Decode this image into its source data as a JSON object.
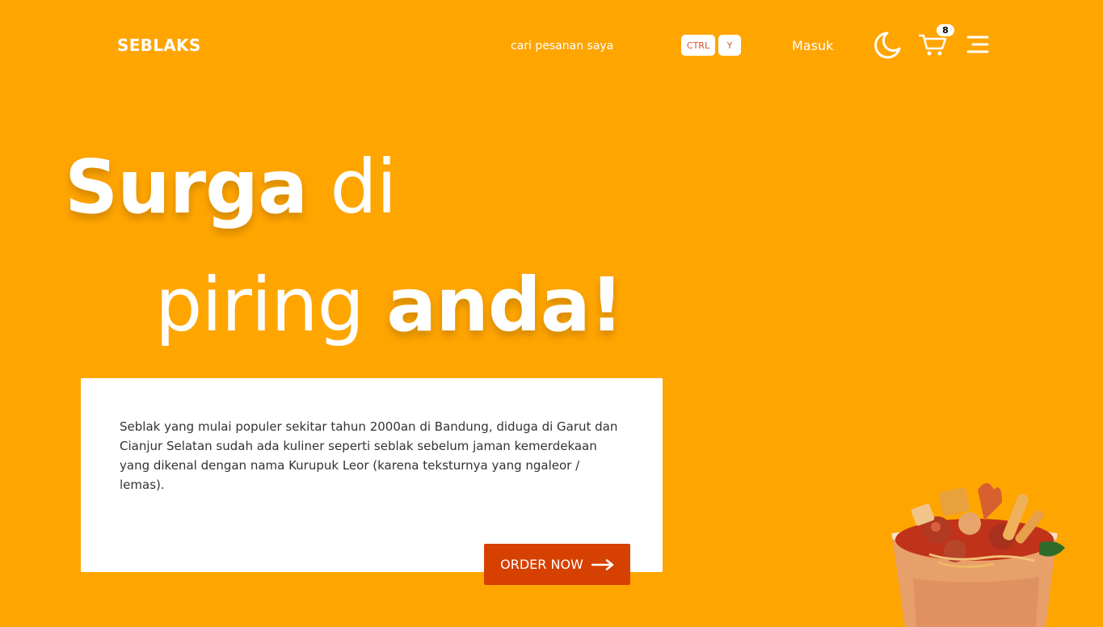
{
  "header": {
    "brand": "SEBLAKS",
    "search_link": "cari pesanan saya",
    "shortcut_keys": [
      "CTRL",
      "Y"
    ],
    "login_label": "Masuk",
    "cart_count": "8",
    "icons": [
      "moon-icon",
      "cart-icon",
      "hamburger-menu-icon"
    ]
  },
  "hero": {
    "line1_bold": "Surga",
    "line1_light": " di",
    "line2_light": "piring ",
    "line2_bold": "anda!"
  },
  "card": {
    "description": "Seblak yang mulai populer sekitar tahun 2000an di Bandung, diduga di Garut dan Cianjur Selatan sudah ada kuliner seperti seblak sebelum jaman kemerdekaan yang dikenal dengan nama Kurupuk Leor (karena teksturnya yang ngaleor / lemas).",
    "order_button": "ORDER NOW"
  },
  "colors": {
    "background": "#FFA500",
    "button": "#D64000",
    "card": "#FFFFFF",
    "text": "#333333"
  }
}
